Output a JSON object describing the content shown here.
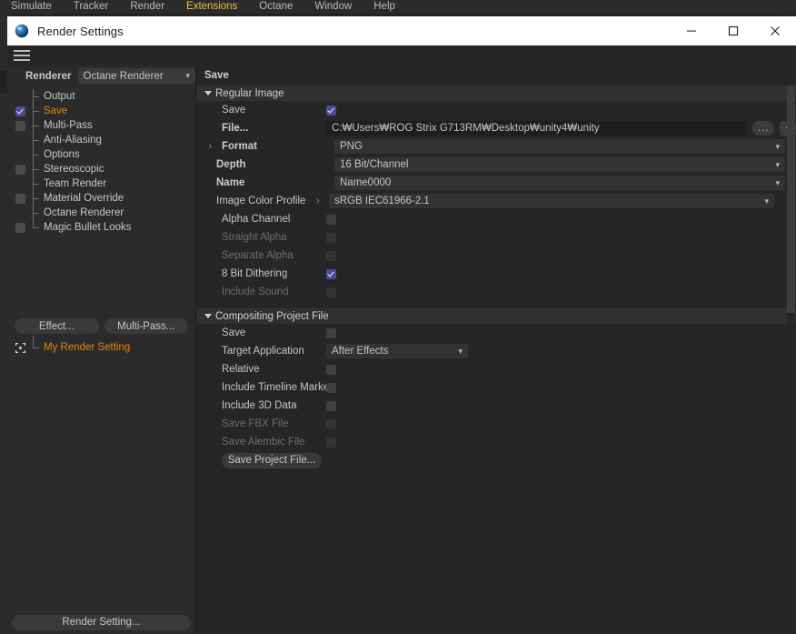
{
  "host": {
    "menubar": [
      {
        "label": "Simulate",
        "highlighted": false
      },
      {
        "label": "Tracker",
        "highlighted": false
      },
      {
        "label": "Render",
        "highlighted": false
      },
      {
        "label": "Extensions",
        "highlighted": true
      },
      {
        "label": "Octane",
        "highlighted": false
      },
      {
        "label": "Window",
        "highlighted": false
      },
      {
        "label": "Help",
        "highlighted": false
      }
    ]
  },
  "window": {
    "title": "Render Settings",
    "icon": "octane-sphere-icon",
    "controls": {
      "minimize": "minimize-icon",
      "maximize": "maximize-icon",
      "close": "close-icon"
    }
  },
  "toolbar": {
    "menu_icon": "hamburger-menu-icon"
  },
  "left": {
    "renderer_label": "Renderer",
    "renderer_value": "Octane Renderer",
    "tree": [
      {
        "label": "Output",
        "checkbox": "none",
        "selected": false
      },
      {
        "label": "Save",
        "checkbox": "checked",
        "selected": true
      },
      {
        "label": "Multi-Pass",
        "checkbox": "unchecked",
        "selected": false
      },
      {
        "label": "Anti-Aliasing",
        "checkbox": "none",
        "selected": false
      },
      {
        "label": "Options",
        "checkbox": "none",
        "selected": false
      },
      {
        "label": "Stereoscopic",
        "checkbox": "unchecked",
        "selected": false
      },
      {
        "label": "Team Render",
        "checkbox": "none",
        "selected": false
      },
      {
        "label": "Material Override",
        "checkbox": "unchecked",
        "selected": false
      },
      {
        "label": "Octane Renderer",
        "checkbox": "none",
        "selected": false
      },
      {
        "label": "Magic Bullet Looks",
        "checkbox": "unchecked",
        "selected": false
      }
    ],
    "effect_button": "Effect...",
    "multipass_button": "Multi-Pass...",
    "render_setting_item": "My Render Setting",
    "render_setting_icon": "corner-marks-icon",
    "footer_button": "Render Setting..."
  },
  "right": {
    "tab_title": "Save",
    "sections": [
      {
        "title": "Regular Image",
        "expanded": true
      },
      {
        "title": "Compositing Project File",
        "expanded": true
      }
    ],
    "regular_image": {
      "save_label": "Save",
      "save_checked": true,
      "file_label": "File...",
      "file_value": "C:₩Users₩ROG Strix G713RM₩Desktop₩unity4₩unity",
      "file_browse": "...",
      "file_menu_icon": "chevron-down-icon",
      "format_label": "Format",
      "format_value": "PNG",
      "depth_label": "Depth",
      "depth_value": "16 Bit/Channel",
      "name_label": "Name",
      "name_value": "Name0000",
      "color_profile_label": "Image Color Profile",
      "color_profile_value": "sRGB IEC61966-2.1",
      "alpha_channel_label": "Alpha Channel",
      "alpha_channel_checked": false,
      "straight_alpha_label": "Straight Alpha",
      "straight_alpha_checked": false,
      "straight_alpha_disabled": true,
      "separate_alpha_label": "Separate Alpha",
      "separate_alpha_checked": false,
      "separate_alpha_disabled": true,
      "dithering_label": "8 Bit Dithering",
      "dithering_checked": true,
      "include_sound_label": "Include Sound",
      "include_sound_checked": false,
      "include_sound_disabled": true
    },
    "compositing": {
      "save_label": "Save",
      "save_checked": false,
      "target_app_label": "Target Application",
      "target_app_value": "After Effects",
      "relative_label": "Relative",
      "relative_checked": false,
      "timeline_marker_label": "Include Timeline Marker",
      "timeline_marker_checked": false,
      "data3d_label": "Include 3D Data",
      "data3d_checked": false,
      "fbx_label": "Save FBX File",
      "fbx_checked": false,
      "fbx_disabled": true,
      "alembic_label": "Save Alembic File",
      "alembic_checked": false,
      "alembic_disabled": true,
      "save_project_button": "Save Project File..."
    }
  },
  "colors": {
    "accent_orange": "#e8820c",
    "checkbox_blue": "#4a4a9c",
    "menu_highlight": "#e8c44a",
    "panel_bg": "#262626",
    "sidebar_bg": "#2b2b2b"
  }
}
